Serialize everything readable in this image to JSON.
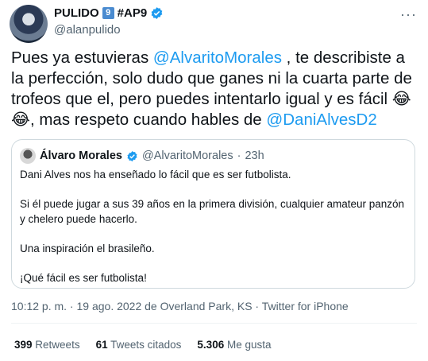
{
  "author": {
    "display_name": "PULIDO",
    "badge_number": "9",
    "hashtag": "#AP9",
    "handle": "@alanpulido"
  },
  "tweet": {
    "text_1": "Pues ya estuvieras ",
    "mention_1": "@AlvaritoMorales",
    "text_2": " , te describiste a la perfección, solo dudo que ganes ni la cuarta parte de trofeos que el, pero puedes intentarlo igual y es fácil ",
    "emoji": "😂😂",
    "text_3": ", mas respeto cuando hables de ",
    "mention_2": "@DaniAlvesD2"
  },
  "quote": {
    "display_name": "Álvaro Morales",
    "handle": "@AlvaritoMorales",
    "separator": "·",
    "time": "23h",
    "paragraphs": [
      "Dani Alves nos ha enseñado lo fácil que es ser futbolista.",
      "Si él puede jugar a sus 39 años en la primera división, cualquier amateur panzón y chelero puede hacerlo.",
      "Una inspiración el brasileño.",
      "¡Qué fácil es ser futbolista!"
    ]
  },
  "meta": {
    "time": "10:12 p. m.",
    "date_location": "19 ago. 2022 de Overland Park, KS",
    "source": "Twitter for iPhone"
  },
  "stats": {
    "retweets_count": "399",
    "retweets_label": "Retweets",
    "quotes_count": "61",
    "quotes_label": "Tweets citados",
    "likes_count": "5.306",
    "likes_label": "Me gusta"
  },
  "colors": {
    "accent": "#1d9bf0",
    "muted": "#536471",
    "border": "#cfd9de"
  }
}
